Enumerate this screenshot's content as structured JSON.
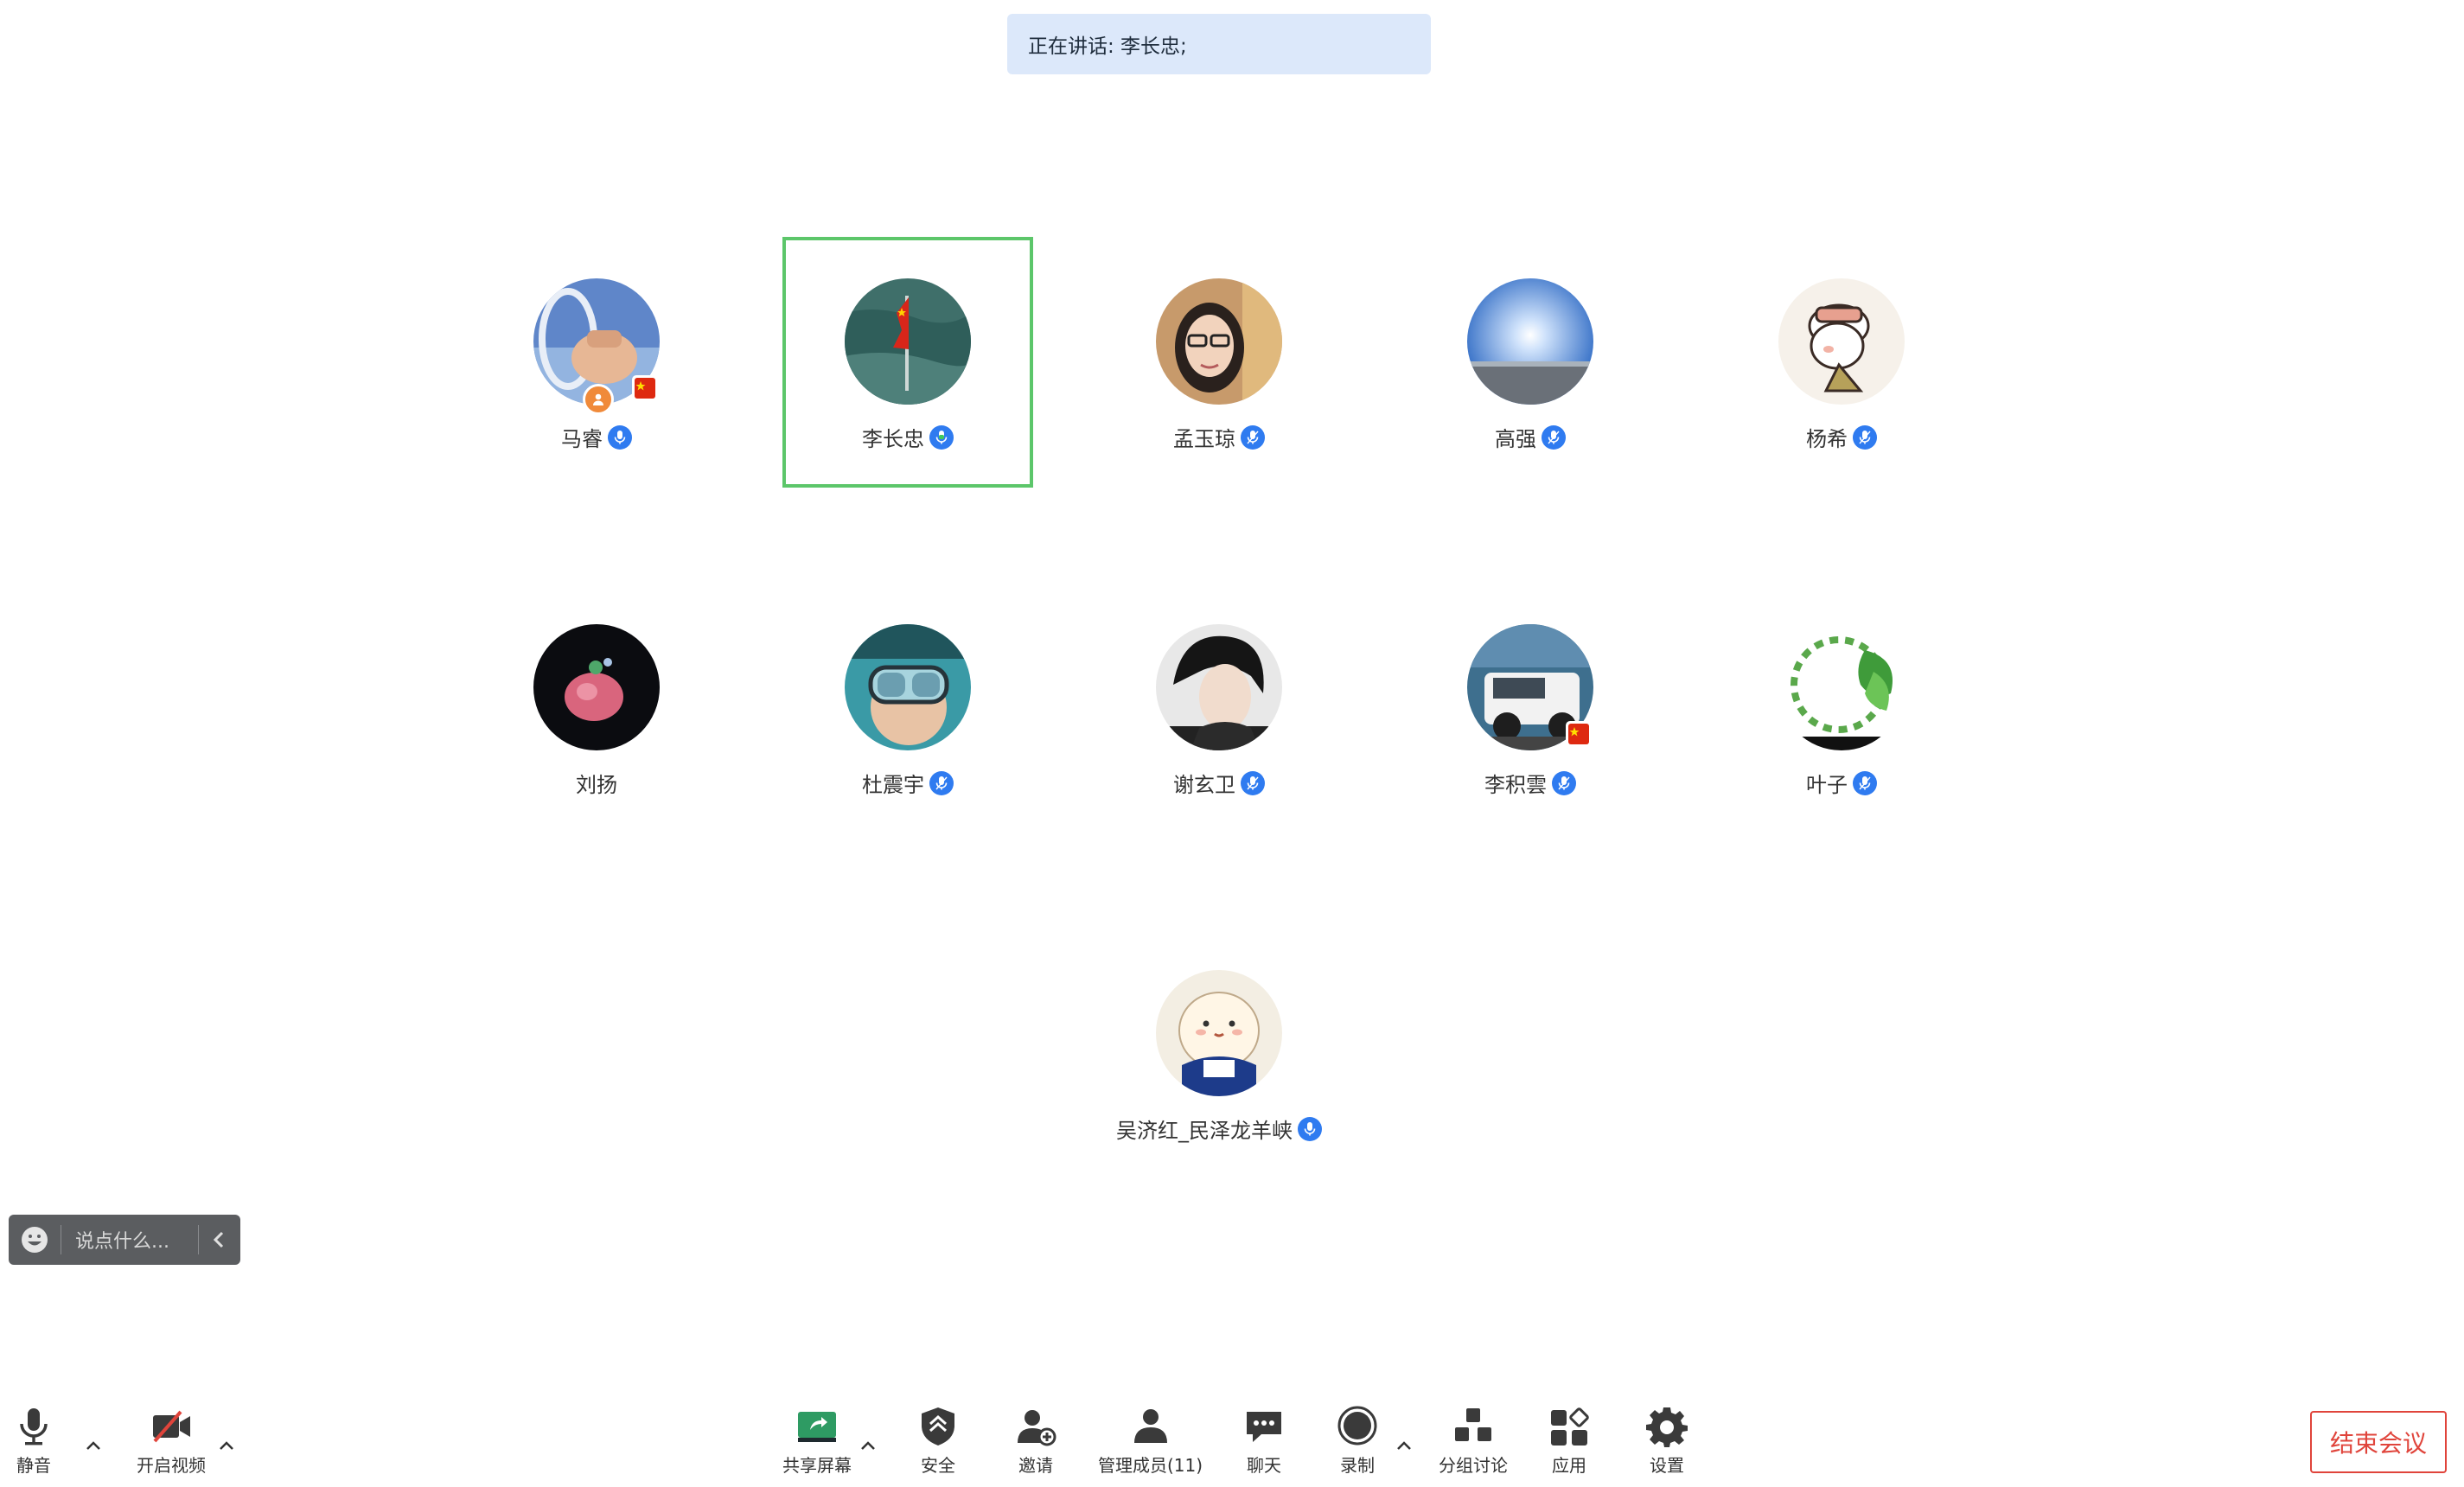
{
  "banner": {
    "speaking_text": "正在讲话: 李长忠;"
  },
  "participants": [
    {
      "name": "马睿",
      "mic": true,
      "host": true,
      "flag": true
    },
    {
      "name": "李长忠",
      "mic": true,
      "speaking": true
    },
    {
      "name": "孟玉琼",
      "mic": true
    },
    {
      "name": "高强",
      "mic": true
    },
    {
      "name": "杨希",
      "mic": true
    },
    {
      "name": "刘扬",
      "mic": false
    },
    {
      "name": "杜震宇",
      "mic": true
    },
    {
      "name": "谢玄卫",
      "mic": true
    },
    {
      "name": "李积雲",
      "mic": true,
      "flag": true
    },
    {
      "name": "叶子",
      "mic": true
    },
    {
      "name": "吴济红_民泽龙羊峡",
      "mic": true
    }
  ],
  "chat": {
    "placeholder": "说点什么..."
  },
  "toolbar": {
    "mute_label": "静音",
    "video_label": "开启视频",
    "share_label": "共享屏幕",
    "security_label": "安全",
    "invite_label": "邀请",
    "members_label": "管理成员(11)",
    "chat_label": "聊天",
    "record_label": "录制",
    "breakout_label": "分组讨论",
    "apps_label": "应用",
    "settings_label": "设置",
    "end_label": "结束会议"
  },
  "colors": {
    "accent": "#2f7bf0",
    "active_border": "#5cc66a",
    "banner_bg": "#dce8fa",
    "end_red": "#e0443b",
    "share_green": "#2e9b63"
  }
}
